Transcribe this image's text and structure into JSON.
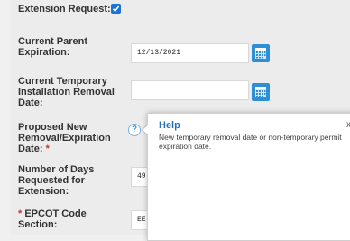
{
  "form": {
    "extension_request_label": "Extension Request:",
    "extension_request_checked": true,
    "current_parent_expiration_label_1": "Current Parent",
    "current_parent_expiration_label_2": "Expiration:",
    "current_parent_expiration_value": "12/13/2021",
    "current_temp_removal_label_1": "Current Temporary",
    "current_temp_removal_label_2": "Installation Removal",
    "current_temp_removal_label_3": "Date:",
    "current_temp_removal_value": "",
    "proposed_label_1": "Proposed New",
    "proposed_label_2": "Removal/Expiration",
    "proposed_label_3": "Date:",
    "required_marker": "*",
    "days_label_1": "Number of Days",
    "days_label_2": "Requested for",
    "days_label_3": "Extension:",
    "days_value": "49",
    "epcot_label_1": "EPCOT Code",
    "epcot_label_2": "Section:",
    "epcot_value": "EE"
  },
  "help_popover": {
    "help_icon": "?",
    "title": "Help",
    "close": "x",
    "body": "New temporary removal date or non-temporary permit expiration date."
  },
  "icons": {
    "calendar": "calendar-icon",
    "checkbox": "checkmark-icon"
  },
  "colors": {
    "accent": "#2f8fd6",
    "checkbox": "#1a73d9",
    "required": "#c0392b",
    "help_title": "#2a6fb8"
  }
}
